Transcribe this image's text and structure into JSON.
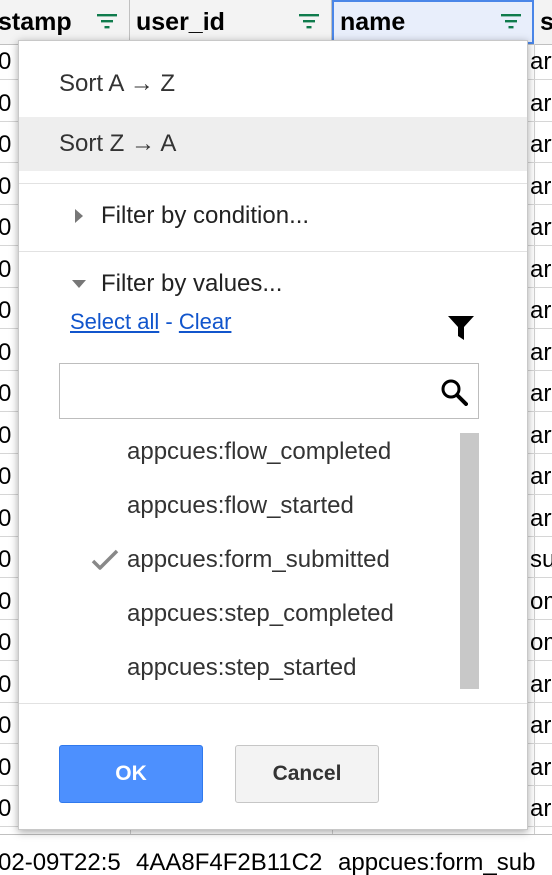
{
  "header": {
    "columns": [
      {
        "label": "stamp"
      },
      {
        "label": "user_id"
      },
      {
        "label": "name"
      },
      {
        "label": "s"
      }
    ]
  },
  "grid": {
    "left_glyph": "0",
    "right_fragments": [
      "art",
      "ar",
      "art",
      "ar",
      "art",
      "ar",
      "ar",
      "art",
      "ar",
      "art",
      "ar",
      "art",
      "sub",
      "om",
      "om",
      "ar",
      "ar",
      "ar",
      "ar"
    ]
  },
  "bottom_row": {
    "c1": "02-09T22:5",
    "c2": "4AA8F4F2B11C2",
    "c3": "appcues:form_sub",
    "c3_tail": "sub"
  },
  "popup": {
    "sort_asc": "Sort A → Z",
    "sort_desc": "Sort Z → A",
    "filter_condition": "Filter by condition...",
    "filter_values": "Filter by values...",
    "select_all": "Select all",
    "link_sep": "-",
    "clear": "Clear",
    "search_value": "",
    "values": [
      {
        "label": "appcues:flow_completed",
        "checked": false
      },
      {
        "label": "appcues:flow_started",
        "checked": false
      },
      {
        "label": "appcues:form_submitted",
        "checked": true
      },
      {
        "label": "appcues:step_completed",
        "checked": false
      },
      {
        "label": "appcues:step_started",
        "checked": false
      }
    ],
    "ok_label": "OK",
    "cancel_label": "Cancel"
  },
  "colors": {
    "accent": "#4d90fe",
    "filter_icon_green": "#0f7b4c",
    "link": "#1155cc",
    "selected_column": "#4a86e8"
  },
  "icons": {
    "check": "checkmark-icon",
    "search": "search-icon",
    "funnel": "funnel-icon",
    "column_filter": "column-filter-icon"
  }
}
